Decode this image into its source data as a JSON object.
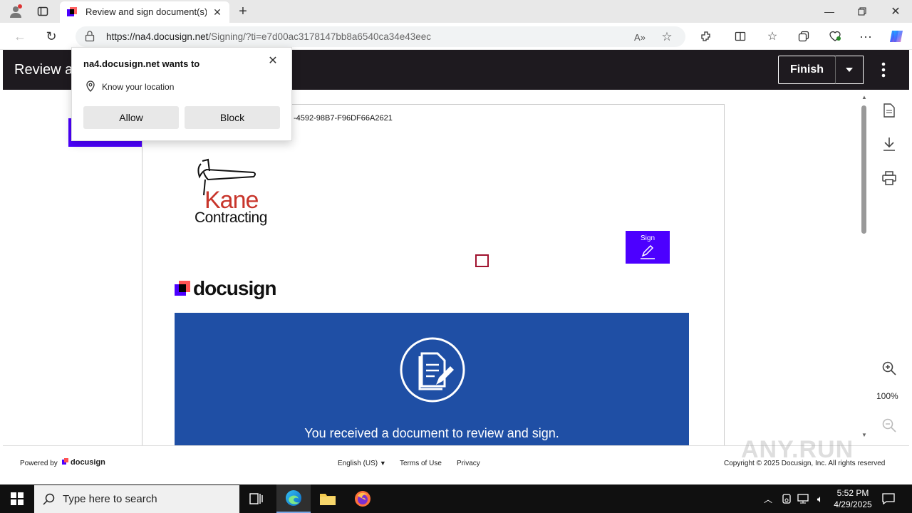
{
  "browser": {
    "tab_title": "Review and sign document(s) | D",
    "url_host": "https://na4.docusign.net",
    "url_path": "/Signing/?ti=e7d00ac3178147bb8a6540ca34e43eec"
  },
  "header": {
    "title": "Review a",
    "finish_label": "Finish"
  },
  "popup": {
    "title": "na4.docusign.net wants to",
    "permission": "Know your location",
    "allow_label": "Allow",
    "block_label": "Block"
  },
  "document": {
    "envelope_id_fragment": "-4592-98B7-F96DF66A2621",
    "company_name_1": "Kane",
    "company_name_2": "Contracting",
    "sign_tag_label": "Sign",
    "docusign_logo_text": "docusign",
    "banner_text": "You received a document to review and sign."
  },
  "toolbar": {
    "zoom_level": "100%"
  },
  "footer": {
    "powered_by": "Powered by",
    "logo_text": "docusign",
    "language": "English (US)",
    "terms": "Terms of Use",
    "privacy": "Privacy",
    "copyright": "Copyright © 2025 Docusign, Inc. All rights reserved"
  },
  "taskbar": {
    "search_placeholder": "Type here to search",
    "time": "5:52 PM",
    "date": "4/29/2025"
  },
  "watermark": "ANY.RUN",
  "colors": {
    "accent_purple": "#4c00ff",
    "header_dark": "#1e1a1f",
    "banner_blue": "#1f4fa5",
    "kane_red": "#c8352b"
  }
}
